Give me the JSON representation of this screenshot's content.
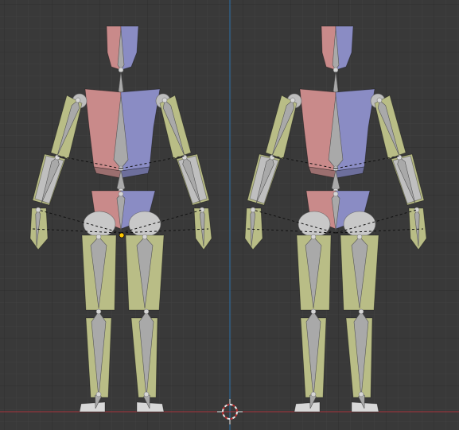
{
  "viewport": {
    "background": "#393939",
    "grid_minor_color": "#414141",
    "grid_major_color": "#2e2e2e",
    "x_axis_color": "#a8343c",
    "z_axis_color": "#2a6fa8",
    "cursor_icon": "3d-cursor-icon"
  },
  "colors": {
    "limb": "#b9bd86",
    "limb_dark": "#7c7f57",
    "bone": "#a9a9a9",
    "bone_light": "#cfcfcf",
    "joint": "#d6d6d6",
    "left_side": "#c98a8a",
    "right_side": "#8a8cc4",
    "relation_line": "#111111",
    "origin_dot": "#ffc800"
  },
  "armatures": [
    {
      "name": "armature-left",
      "has_origin": true
    },
    {
      "name": "armature-right",
      "has_origin": false
    }
  ]
}
